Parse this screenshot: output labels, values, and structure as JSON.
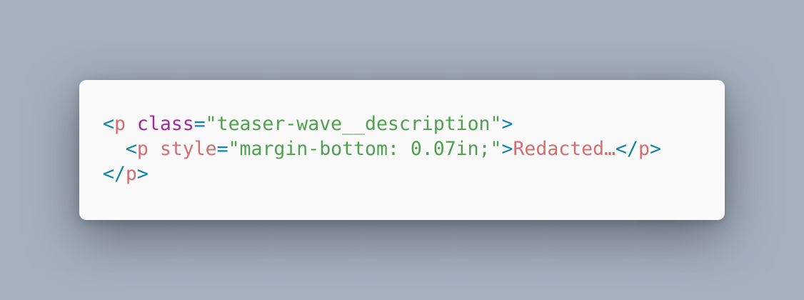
{
  "colors": {
    "background": "#a5b1bd",
    "card": "#fafafa",
    "punctuation": "#0f84a8",
    "tag": "#d36d6f",
    "keyword_attr": "#a626a4",
    "string": "#50a14f"
  },
  "code": {
    "line1": {
      "open_bracket": "<",
      "tag": "p",
      "space": " ",
      "attr": "class",
      "equals": "=",
      "value": "\"teaser-wave__description\"",
      "close_bracket": ">"
    },
    "line2": {
      "indent": "  ",
      "open_bracket": "<",
      "tag": "p",
      "space": " ",
      "attr": "style",
      "equals": "=",
      "value": "\"margin-bottom: 0.07in;\"",
      "close_bracket": ">",
      "text": "Redacted…",
      "end_open": "</",
      "end_tag": "p",
      "end_close": ">"
    },
    "line3": {
      "end_open": "</",
      "end_tag": "p",
      "end_close": ">"
    }
  }
}
